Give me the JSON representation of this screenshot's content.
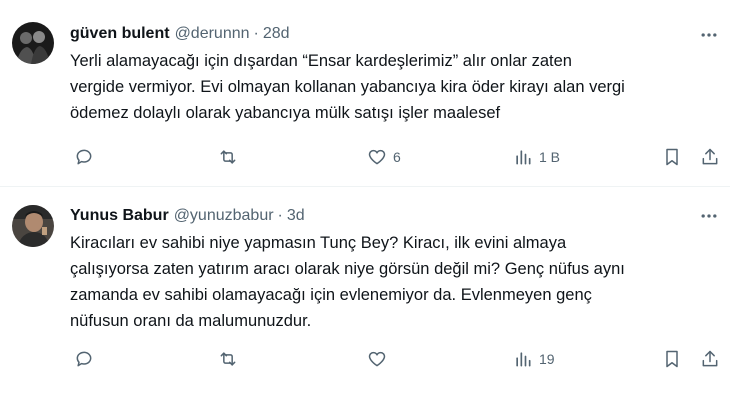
{
  "tweets": [
    {
      "name": "güven bulent",
      "handle": "@derunnn",
      "time": "28d",
      "text_lines": [
        "Yerli alamayacağı için dışardan “Ensar kardeşlerimiz” alır onlar zaten",
        "vergide vermiyor. Evi olmayan kollanan yabancıya  kira öder kirayı alan vergi",
        "ödemez dolaylı olarak yabancıya mülk satışı işler maalesef"
      ],
      "likes": "6",
      "views": "1 B"
    },
    {
      "name": "Yunus Babur",
      "handle": "@yunuzbabur",
      "time": "3d",
      "text_lines": [
        "Kiracıları ev sahibi niye yapmasın Tunç Bey? Kiracı, ilk evini almaya",
        "çalışıyorsa zaten yatırım aracı olarak niye görsün değil mi? Genç nüfus aynı",
        "zamanda ev sahibi olamayacağı için evlenemiyor da. Evlenmeyen genç",
        "nüfusun oranı da malumunuzdur."
      ],
      "likes": "",
      "views": "19"
    }
  ],
  "separator": "·",
  "icons": {
    "more": "more-horizontal-icon",
    "reply": "reply-bubble-icon",
    "retweet": "retweet-arrows-icon",
    "like": "heart-icon",
    "views": "bar-chart-icon",
    "bookmark": "bookmark-icon",
    "share": "share-upload-icon"
  },
  "colors": {
    "text": "#0f1419",
    "secondary": "#536471",
    "divider": "#eff3f4"
  }
}
